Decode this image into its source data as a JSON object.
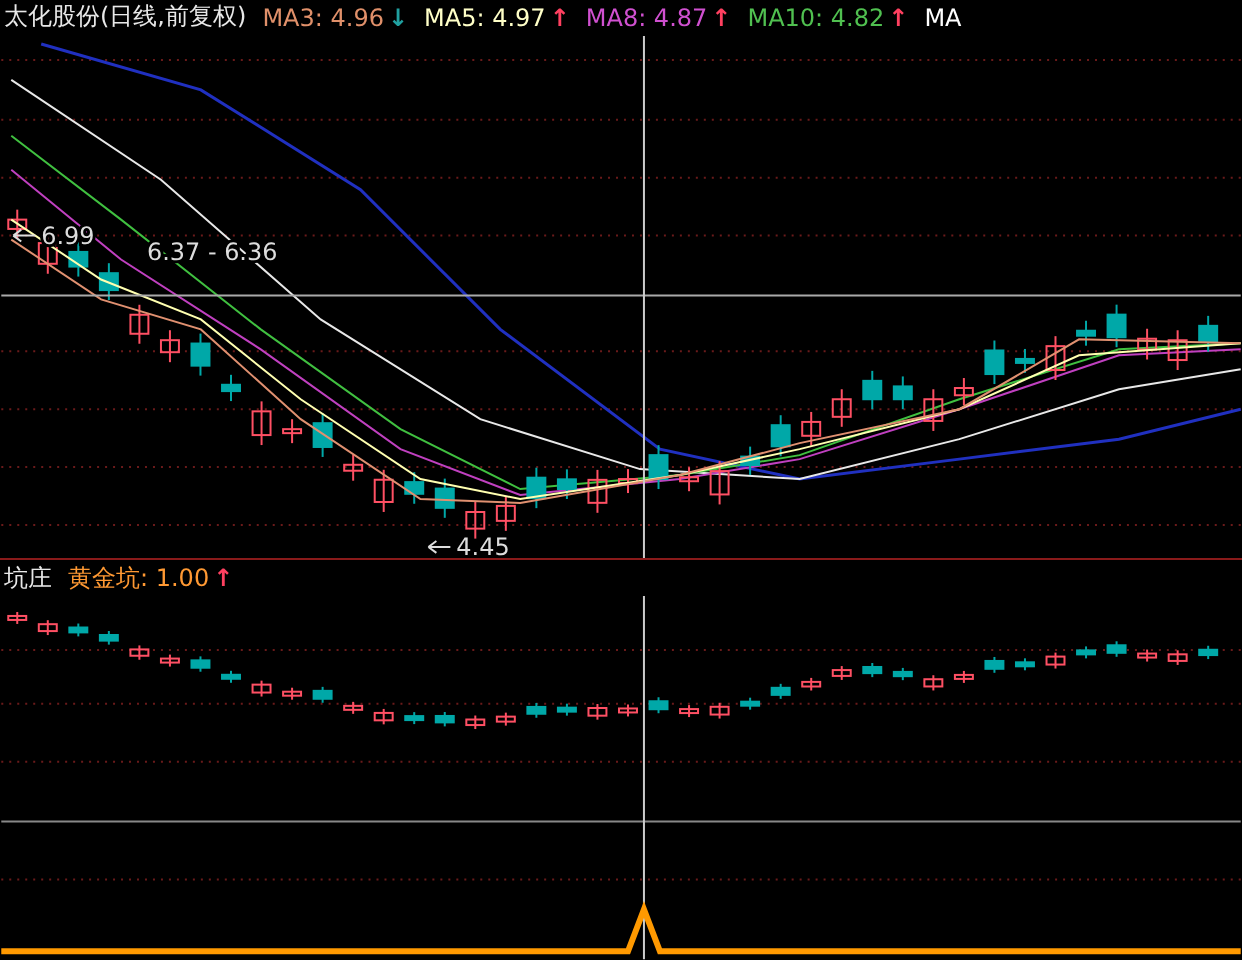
{
  "main_panel": {
    "title": "太化股份(日线,前复权)",
    "indicators": [
      {
        "text": "MA3: 4.96",
        "color": "#e0906a",
        "arrow": {
          "text": "↓",
          "color": "#20a0a0"
        }
      },
      {
        "text": "MA5: 4.97",
        "color": "#ffffc8",
        "arrow": {
          "text": "↑",
          "color": "#ff4060"
        }
      },
      {
        "text": "MA8: 4.87",
        "color": "#d050d0",
        "arrow": {
          "text": "↑",
          "color": "#ff4060"
        }
      },
      {
        "text": "MA10: 4.82",
        "color": "#50c050",
        "arrow": {
          "text": "↑",
          "color": "#ff4060"
        }
      },
      {
        "text": "MA",
        "color": "#ffffff"
      }
    ],
    "price_labels": [
      {
        "text": "6.99",
        "kind": "arrow"
      },
      {
        "text": "6.37 - 6.36",
        "kind": "plain"
      },
      {
        "text": "4.45",
        "kind": "arrow"
      }
    ]
  },
  "lower_panel": {
    "title": "坑庄",
    "indicators": [
      {
        "text": "黄金坑: 1.00",
        "color": "#ff9933",
        "arrow": {
          "text": "↑",
          "color": "#ff4060"
        }
      }
    ]
  }
}
